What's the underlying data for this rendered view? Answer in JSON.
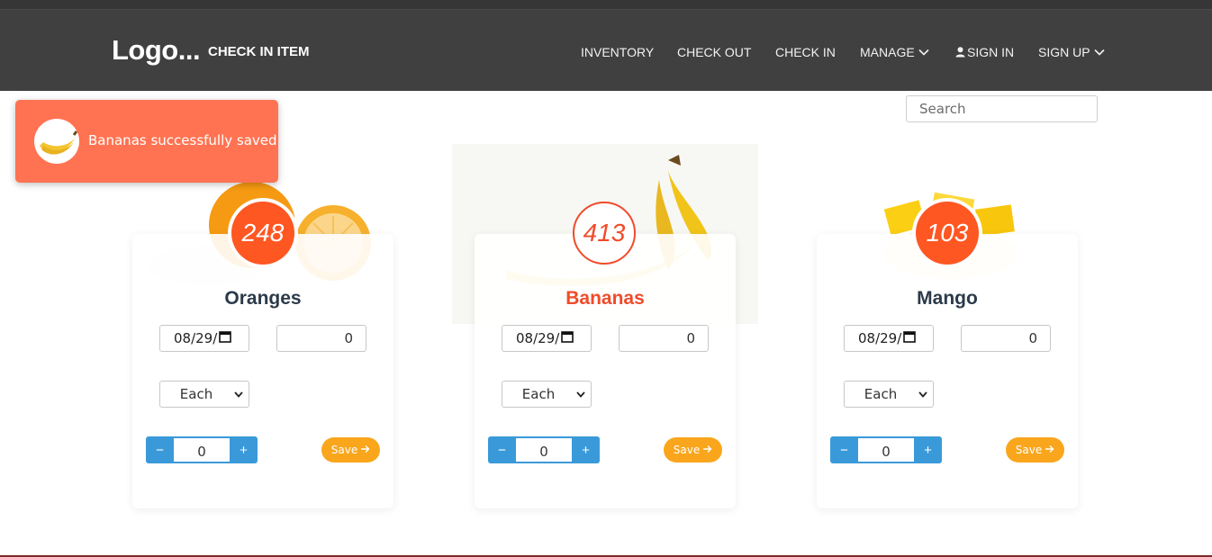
{
  "header": {
    "brand": "Logo...",
    "page_title": "CHECK IN ITEM",
    "nav": [
      {
        "label": "INVENTORY"
      },
      {
        "label": "CHECK OUT"
      },
      {
        "label": "CHECK IN"
      },
      {
        "label": "MANAGE",
        "icon": "chevron-down-icon"
      },
      {
        "label": "SIGN IN",
        "icon": "user-icon"
      },
      {
        "label": "SIGN UP",
        "icon": "chevron-down-icon"
      }
    ]
  },
  "search": {
    "placeholder": "Search"
  },
  "toast": {
    "message": "Bananas successfully saved",
    "icon": "banana-thumbnail"
  },
  "colors": {
    "nav_bg": "#404040",
    "toast_bg": "#ff7352",
    "badge": "#ff5722",
    "active_name": "#f04b2a",
    "stepper": "#3a9ad9",
    "save_button": "#f9a61d"
  },
  "cards": [
    {
      "name": "Oranges",
      "count": "248",
      "date": "08/29/",
      "quantity": "0",
      "unit": "Each",
      "stepper_value": "0",
      "stepper_minus": "−",
      "stepper_plus": "+",
      "save_label": "Save",
      "active": false
    },
    {
      "name": "Bananas",
      "count": "413",
      "date": "08/29/",
      "quantity": "0",
      "unit": "Each",
      "stepper_value": "0",
      "stepper_minus": "−",
      "stepper_plus": "+",
      "save_label": "Save",
      "active": true
    },
    {
      "name": "Mango",
      "count": "103",
      "date": "08/29/",
      "quantity": "0",
      "unit": "Each",
      "stepper_value": "0",
      "stepper_minus": "−",
      "stepper_plus": "+",
      "save_label": "Save",
      "active": false
    }
  ]
}
